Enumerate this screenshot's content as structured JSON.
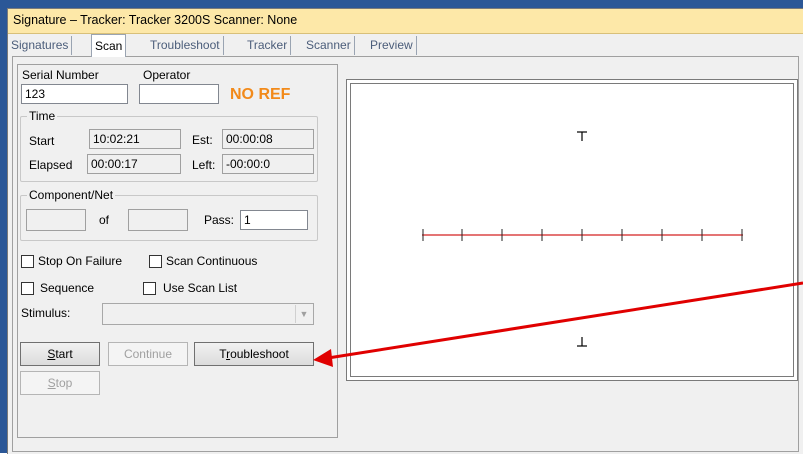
{
  "window": {
    "title": "Signature – Tracker: Tracker 3200S  Scanner: None"
  },
  "tabs": [
    {
      "label": "Signatures",
      "active": false
    },
    {
      "label": "Scan",
      "active": true
    },
    {
      "label": "Troubleshoot",
      "active": false
    },
    {
      "label": "Tracker",
      "active": false
    },
    {
      "label": "Scanner",
      "active": false
    },
    {
      "label": "Preview",
      "active": false
    }
  ],
  "scan": {
    "serial_label": "Serial Number",
    "serial_value": "123",
    "operator_label": "Operator",
    "operator_value": "",
    "status": "NO REF",
    "status_color": "#f28a1a",
    "time": {
      "legend": "Time",
      "start_label": "Start",
      "start_value": "10:02:21",
      "est_label": "Est:",
      "est_value": "00:00:08",
      "elapsed_label": "Elapsed",
      "elapsed_value": "00:00:17",
      "left_label": "Left:",
      "left_value": "-00:00:0"
    },
    "component": {
      "legend": "Component/Net",
      "current_value": "",
      "of_label": "of",
      "total_value": "",
      "pass_label": "Pass:",
      "pass_value": "1"
    },
    "options": {
      "stop_on_failure": "Stop On Failure",
      "scan_continuous": "Scan Continuous",
      "sequence": "Sequence",
      "use_scan_list": "Use Scan List"
    },
    "stimulus_label": "Stimulus:",
    "stimulus_value": "",
    "buttons": {
      "start": {
        "first": "S",
        "rest": "tart"
      },
      "continue": "Continue",
      "troubleshoot": {
        "before": "T",
        "underline": "r",
        "after": "oubleshoot"
      },
      "stop": {
        "first": "S",
        "rest": "top"
      }
    }
  },
  "signature_plot": {
    "line_color": "#d42020",
    "annotation_arrow_color": "#e00000"
  }
}
